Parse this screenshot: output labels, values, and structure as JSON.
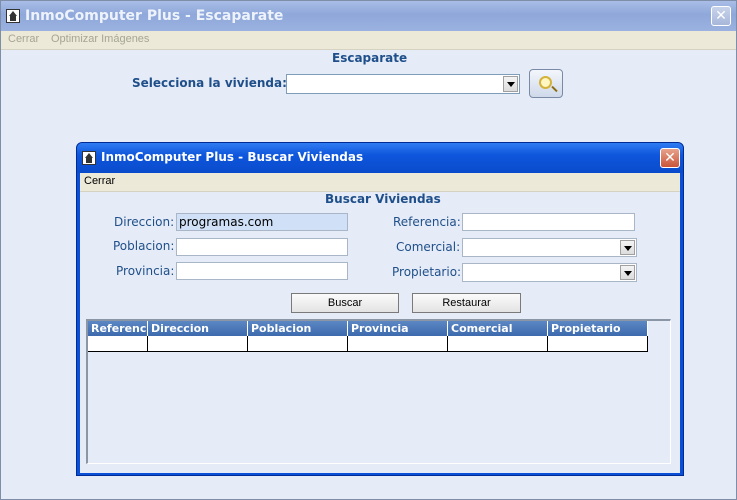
{
  "main_window": {
    "title": "InmoComputer Plus - Escaparate",
    "close_glyph": "✕",
    "menu": [
      "Cerrar",
      "Optimizar Imágenes"
    ],
    "section_title": "Escaparate",
    "select_label": "Selecciona la vivienda:",
    "select_value": "",
    "icon_button": "search-folder-icon"
  },
  "dialog": {
    "title": "InmoComputer Plus - Buscar Viviendas",
    "close_glyph": "✕",
    "menu": [
      "Cerrar"
    ],
    "section_title": "Buscar Viviendas",
    "fields": {
      "direccion": {
        "label": "Direccion:",
        "value": "programas.com"
      },
      "poblacion": {
        "label": "Poblacion:",
        "value": ""
      },
      "provincia": {
        "label": "Provincia:",
        "value": ""
      },
      "referencia": {
        "label": "Referencia:",
        "value": ""
      },
      "comercial": {
        "label": "Comercial:",
        "value": ""
      },
      "propietario": {
        "label": "Propietario:",
        "value": ""
      }
    },
    "buttons": {
      "search": "Buscar",
      "reset": "Restaurar"
    },
    "table": {
      "columns": [
        "Referencia",
        "Direccion",
        "Poblacion",
        "Provincia",
        "Comercial",
        "Propietario"
      ],
      "rows": []
    }
  },
  "colors": {
    "accent_blue": "#1f4f8a",
    "active_title": "#0a4fd6",
    "inactive_title": "#8fa8da",
    "header_blue": "#3d6aad",
    "field_highlight": "#cfe0f7"
  }
}
